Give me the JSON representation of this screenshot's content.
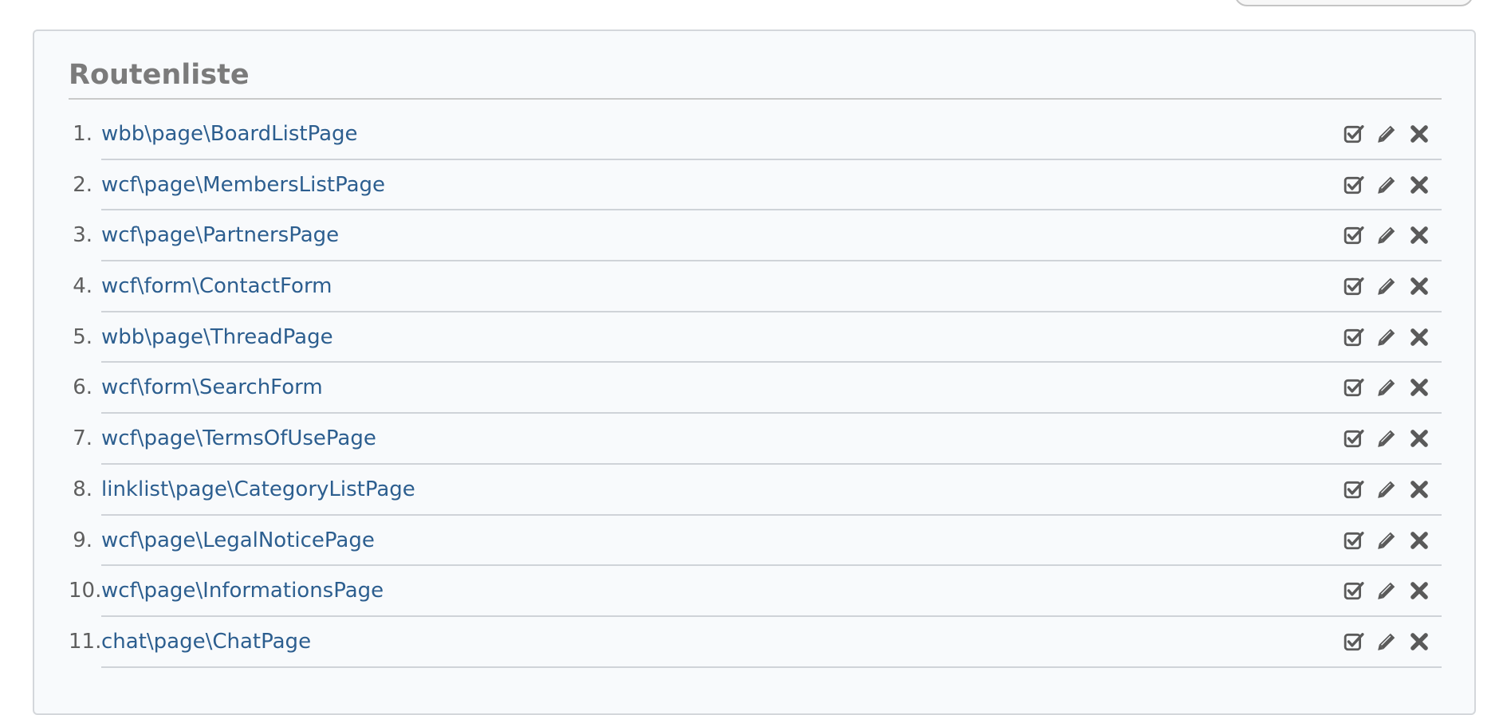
{
  "panel": {
    "title": "Routenliste"
  },
  "routes": [
    {
      "number": "1.",
      "name": "wbb\\page\\BoardListPage"
    },
    {
      "number": "2.",
      "name": "wcf\\page\\MembersListPage"
    },
    {
      "number": "3.",
      "name": "wcf\\page\\PartnersPage"
    },
    {
      "number": "4.",
      "name": "wcf\\form\\ContactForm"
    },
    {
      "number": "5.",
      "name": "wbb\\page\\ThreadPage"
    },
    {
      "number": "6.",
      "name": "wcf\\form\\SearchForm"
    },
    {
      "number": "7.",
      "name": "wcf\\page\\TermsOfUsePage"
    },
    {
      "number": "8.",
      "name": "linklist\\page\\CategoryListPage"
    },
    {
      "number": "9.",
      "name": "wcf\\page\\LegalNoticePage"
    },
    {
      "number": "10.",
      "name": "wcf\\page\\InformationsPage"
    },
    {
      "number": "11.",
      "name": "chat\\page\\ChatPage"
    }
  ],
  "row_actions": [
    "check-square-icon",
    "pencil-icon",
    "close-icon"
  ],
  "colors": {
    "link": "#2c5e8f",
    "title": "#7b7b7b",
    "icon": "#5a5a5a",
    "panel_background": "#f8fafc",
    "panel_border": "#d4d7db"
  }
}
